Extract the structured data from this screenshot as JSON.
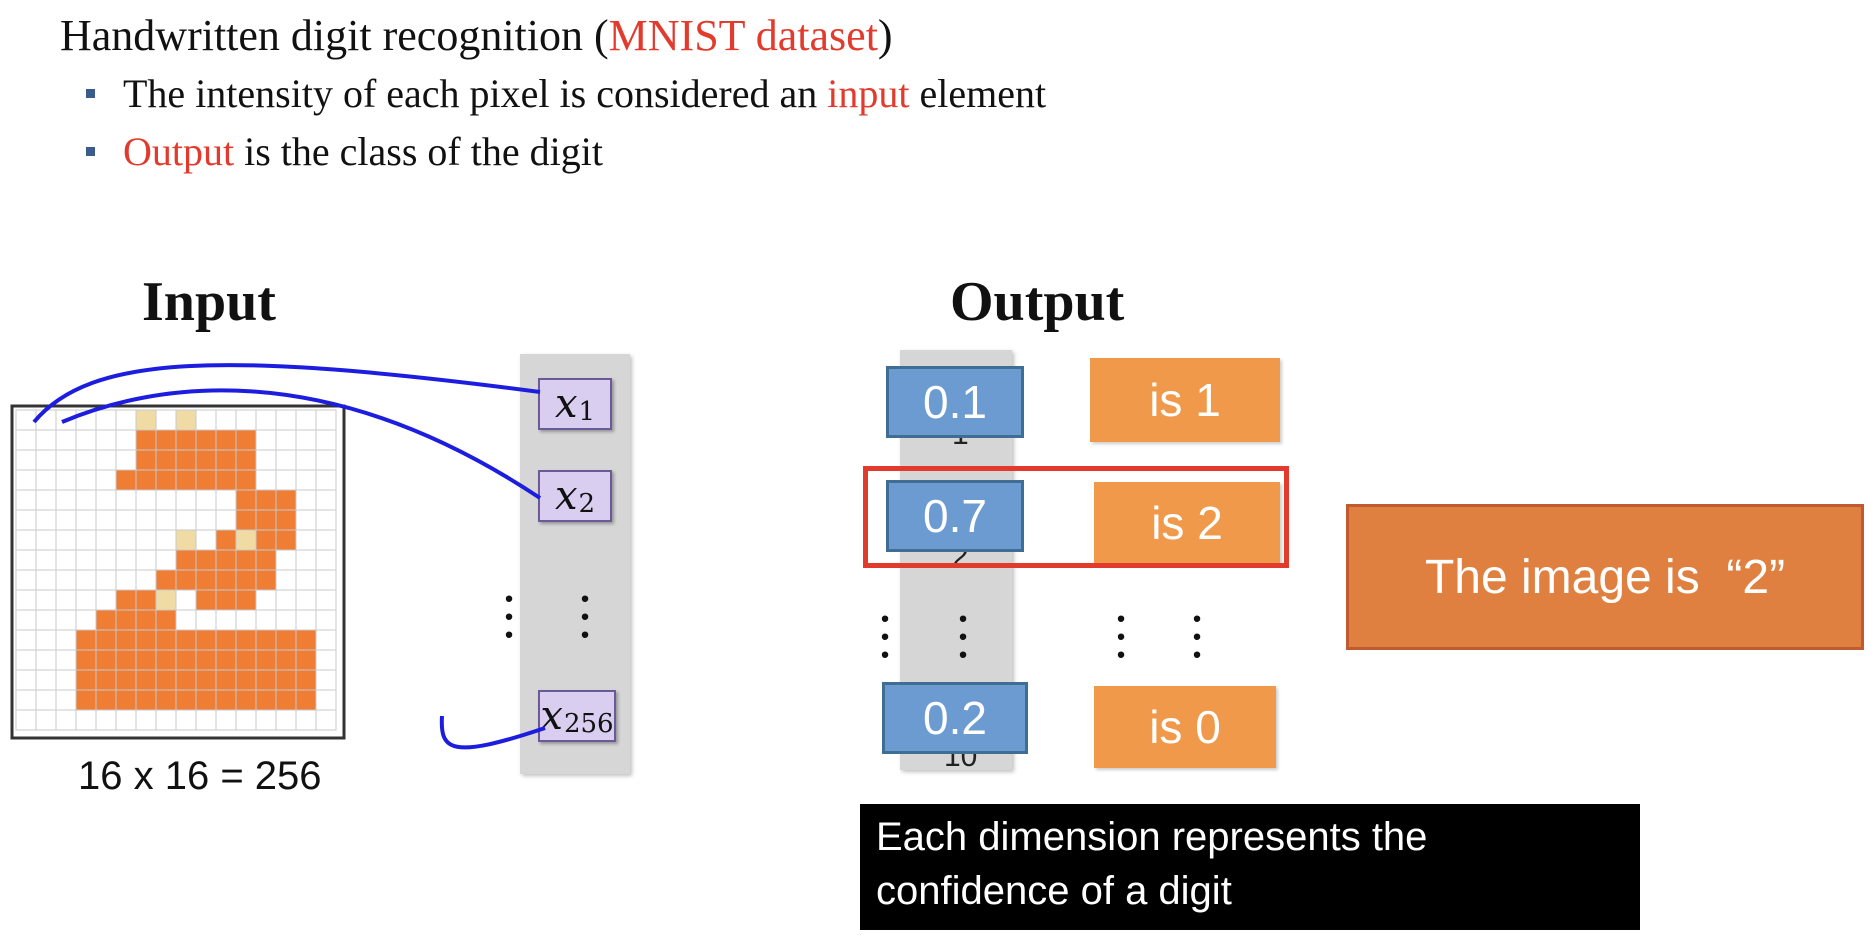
{
  "header": {
    "title_prefix": "Handwritten digit recognition (",
    "title_highlight": "MNIST dataset",
    "title_suffix": ")",
    "bullets": [
      {
        "pre": "The intensity of each pixel is considered an ",
        "highlight": "input",
        "post": " element"
      },
      {
        "pre": "",
        "highlight": "Output",
        "post": " is the class of the digit"
      }
    ]
  },
  "input": {
    "heading": "Input",
    "grid_caption": "16 x 16 = 256",
    "grid_size": 16,
    "pixel_rows": [
      "......O.O.......",
      "......OOOOOO....",
      "......OOOOOO....",
      ".....OOOOOOO....",
      "...........OOO..",
      "...........OOO..",
      "........O.OOOO..",
      "........OOOOO...",
      ".......OOOOOO...",
      ".....OOO.OOO....",
      "....OOOO........",
      "...OOOOOOOOOOOO.",
      "...OOOOOOOOOOOO.",
      "...OOOOOOOOOOOO.",
      "...OOOOOOOOOOOO.",
      "................"
    ],
    "faint_pixels": [
      [
        0,
        6
      ],
      [
        0,
        8
      ],
      [
        6,
        8
      ],
      [
        6,
        11
      ],
      [
        9,
        7
      ]
    ],
    "elements": [
      {
        "var": "x",
        "sub": "1"
      },
      {
        "var": "x",
        "sub": "2"
      },
      {
        "var": "x",
        "sub": "256"
      }
    ]
  },
  "output": {
    "heading": "Output",
    "values": [
      "0.1",
      "0.7",
      "0.2"
    ],
    "classes": [
      "is 1",
      "is 2",
      "is 0"
    ],
    "hidden_subscripts": [
      "1",
      "2",
      "10"
    ],
    "highlighted_index": 1,
    "result_text": "The image is  “2”",
    "caption_lines": [
      "Each dimension represents the",
      "confidence of a digit"
    ]
  },
  "colors": {
    "highlight_red": "#e23b2e",
    "digit_orange": "#ef7d33",
    "faint_pixel": "#efdba3",
    "value_blue": "#6c9bd2",
    "class_orange": "#f0994a",
    "line_blue": "#1d1de0"
  }
}
